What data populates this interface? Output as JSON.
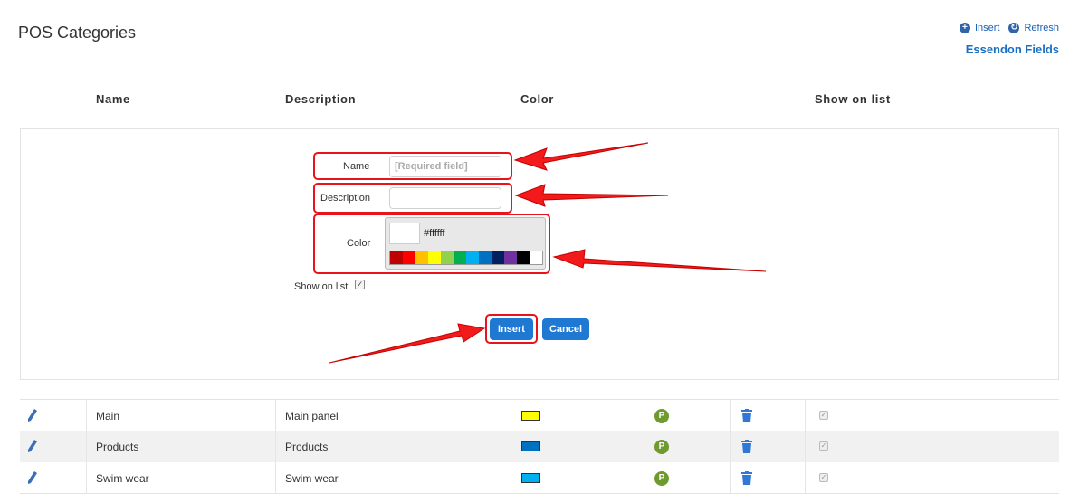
{
  "page": {
    "title": "POS Categories"
  },
  "actions": {
    "insert_label": "Insert",
    "refresh_label": "Refresh",
    "site_name": "Essendon Fields"
  },
  "columns": {
    "name": "Name",
    "description": "Description",
    "color": "Color",
    "show_on_list": "Show on list"
  },
  "form": {
    "name_label": "Name",
    "name_placeholder": "[Required field]",
    "description_label": "Description",
    "description_value": "",
    "color_label": "Color",
    "color_value": "#ffffff",
    "palette": [
      "#c00000",
      "#ff0000",
      "#ffc000",
      "#ffff00",
      "#92d050",
      "#00b050",
      "#00b0f0",
      "#0070c0",
      "#002060",
      "#7030a0",
      "#000000",
      "#ffffff"
    ],
    "show_on_list_label": "Show on list",
    "show_on_list_checked": true,
    "insert_button": "Insert",
    "cancel_button": "Cancel"
  },
  "rows": [
    {
      "name": "Main",
      "description": "Main panel",
      "color": "#ffff00",
      "badge": "P",
      "show": true
    },
    {
      "name": "Products",
      "description": "Products",
      "color": "#0070c0",
      "badge": "P",
      "show": true
    },
    {
      "name": "Swim wear",
      "description": "Swim wear",
      "color": "#00b0f0",
      "badge": "P",
      "show": true
    }
  ]
}
